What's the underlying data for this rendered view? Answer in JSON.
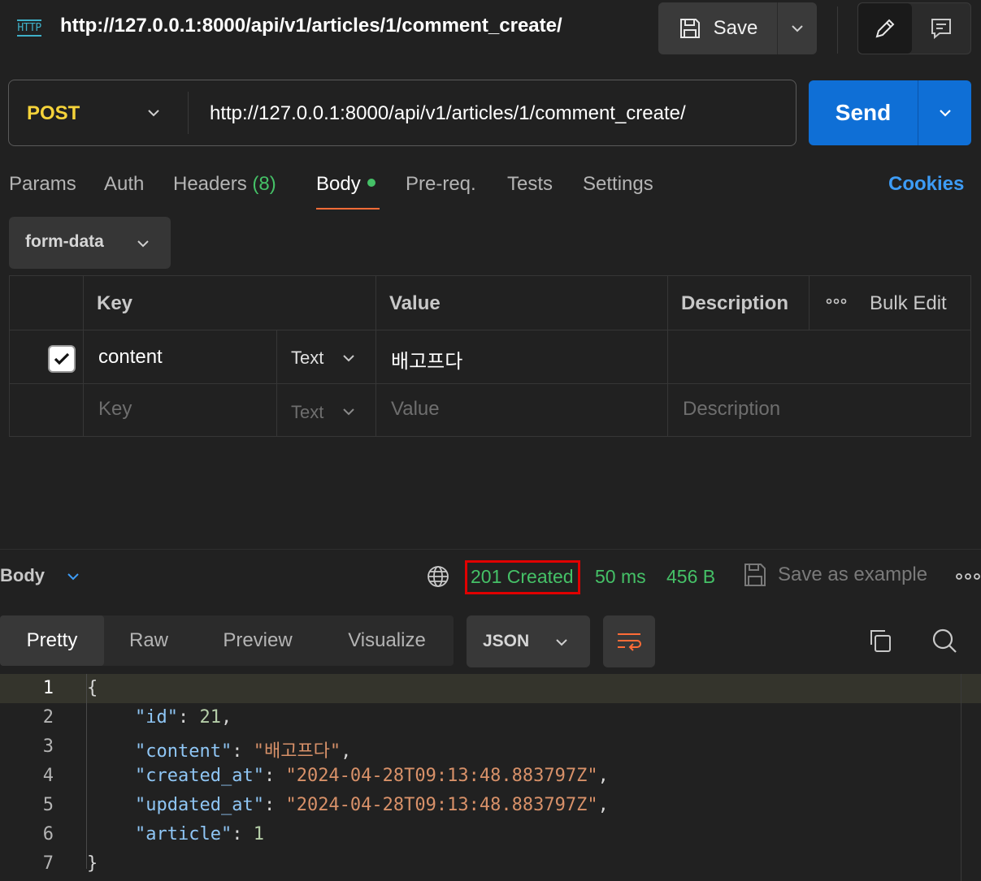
{
  "titlebar": {
    "icon_label": "HTTP",
    "title": "http://127.0.0.1:8000/api/v1/articles/1/comment_create/",
    "save_label": "Save"
  },
  "request": {
    "method": "POST",
    "url": "http://127.0.0.1:8000/api/v1/articles/1/comment_create/",
    "send_label": "Send"
  },
  "tabs": {
    "params": "Params",
    "auth": "Auth",
    "headers": "Headers",
    "headers_count": "(8)",
    "body": "Body",
    "prereq": "Pre-req.",
    "tests": "Tests",
    "settings": "Settings",
    "cookies": "Cookies"
  },
  "body_mode": "form-data",
  "table": {
    "headers": {
      "key": "Key",
      "value": "Value",
      "description": "Description",
      "bulk_edit": "Bulk Edit"
    },
    "rows": [
      {
        "checked": true,
        "key": "content",
        "type": "Text",
        "value": "배고프다",
        "description": ""
      }
    ],
    "placeholder": {
      "key": "Key",
      "type": "Text",
      "value": "Value",
      "description": "Description"
    }
  },
  "response": {
    "body_label": "Body",
    "status": "201 Created",
    "time": "50 ms",
    "size": "456 B",
    "save_example": "Save as example",
    "views": [
      "Pretty",
      "Raw",
      "Preview",
      "Visualize"
    ],
    "active_view": "Pretty",
    "format": "JSON",
    "code_lines": [
      "1",
      "2",
      "3",
      "4",
      "5",
      "6",
      "7"
    ],
    "json": {
      "open": "{",
      "close": "}",
      "id_key": "\"id\"",
      "id_val": "21",
      "content_key": "\"content\"",
      "content_val": "\"배고프다\"",
      "created_key": "\"created_at\"",
      "created_val": "\"2024-04-28T09:13:48.883797Z\"",
      "updated_key": "\"updated_at\"",
      "updated_val": "\"2024-04-28T09:13:48.883797Z\"",
      "article_key": "\"article\"",
      "article_val": "1"
    }
  },
  "colors": {
    "method": "#f5d33a",
    "send": "#0f6fd6",
    "status_ok": "#45c167",
    "cookies": "#3d9cf6",
    "highlight_box": "#e00000",
    "active_tab_underline": "#ff6c37"
  }
}
